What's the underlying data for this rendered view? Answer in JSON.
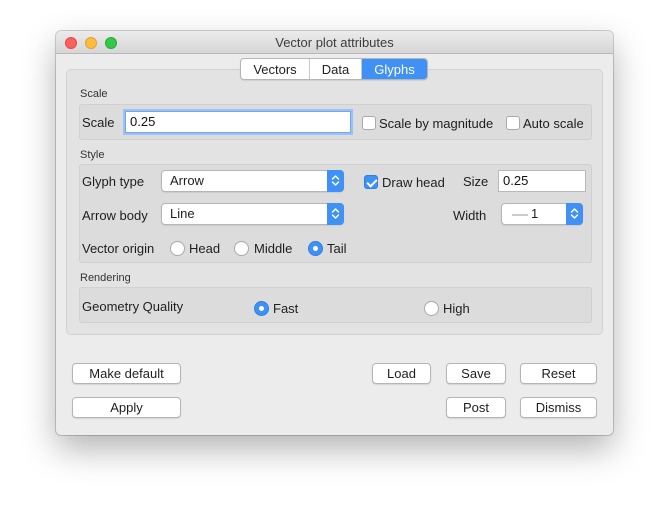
{
  "window": {
    "title": "Vector plot attributes"
  },
  "tabs": [
    {
      "label": "Vectors",
      "active": false
    },
    {
      "label": "Data",
      "active": false
    },
    {
      "label": "Glyphs",
      "active": true
    }
  ],
  "scale": {
    "section_label": "Scale",
    "label": "Scale",
    "value": "0.25",
    "scale_by_magnitude": {
      "label": "Scale by magnitude",
      "checked": false
    },
    "auto_scale": {
      "label": "Auto scale",
      "checked": false
    }
  },
  "style": {
    "section_label": "Style",
    "glyph_type": {
      "label": "Glyph type",
      "value": "Arrow"
    },
    "draw_head": {
      "label": "Draw head",
      "checked": true
    },
    "size": {
      "label": "Size",
      "value": "0.25"
    },
    "arrow_body": {
      "label": "Arrow body",
      "value": "Line"
    },
    "width": {
      "label": "Width",
      "value": "1"
    },
    "vector_origin": {
      "label": "Vector origin",
      "options": [
        "Head",
        "Middle",
        "Tail"
      ],
      "selected": "Tail"
    }
  },
  "rendering": {
    "section_label": "Rendering",
    "geometry_quality": {
      "label": "Geometry Quality",
      "options": [
        "Fast",
        "High"
      ],
      "selected": "Fast"
    }
  },
  "buttons": {
    "make_default": "Make default",
    "load": "Load",
    "save": "Save",
    "reset": "Reset",
    "apply": "Apply",
    "post": "Post",
    "dismiss": "Dismiss"
  },
  "colors": {
    "accent": "#3f91f5",
    "window_bg": "#ececec"
  }
}
